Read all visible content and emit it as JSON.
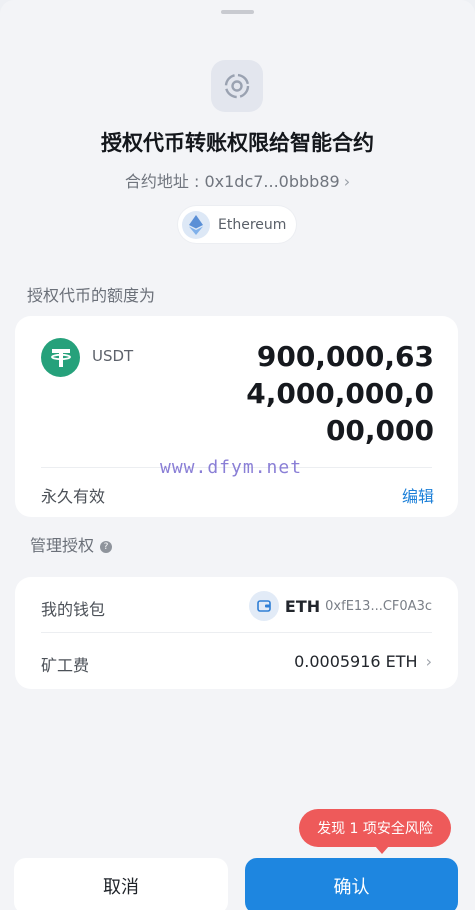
{
  "header": {
    "title": "授权代币转账权限给智能合约",
    "contract_label": "合约地址 : 0x1dc7...0bbb89",
    "chain_name": "Ethereum"
  },
  "allowance": {
    "section_label": "授权代币的额度为",
    "token_symbol": "USDT",
    "amount": "900,000,634,000,000,000,000",
    "duration_label": "永久有效",
    "edit_label": "编辑"
  },
  "manage": {
    "section_label": "管理授权",
    "wallet_label": "我的钱包",
    "wallet_name": "ETH",
    "wallet_address": "0xfE13...CF0A3c",
    "fee_label": "矿工费",
    "fee_value": "0.0005916 ETH"
  },
  "watermark": "www.dfym.net",
  "risk_badge": "发现 1 项安全风险",
  "actions": {
    "cancel_label": "取消",
    "confirm_label": "确认"
  },
  "colors": {
    "accent": "#1e86e0",
    "danger": "#ee5a5a",
    "usdt": "#26a17b",
    "background": "#f3f4f7"
  },
  "icons": [
    "dapp-icon",
    "ethereum-icon",
    "usdt-icon",
    "help-icon",
    "wallet-icon",
    "chevron-right-icon"
  ]
}
